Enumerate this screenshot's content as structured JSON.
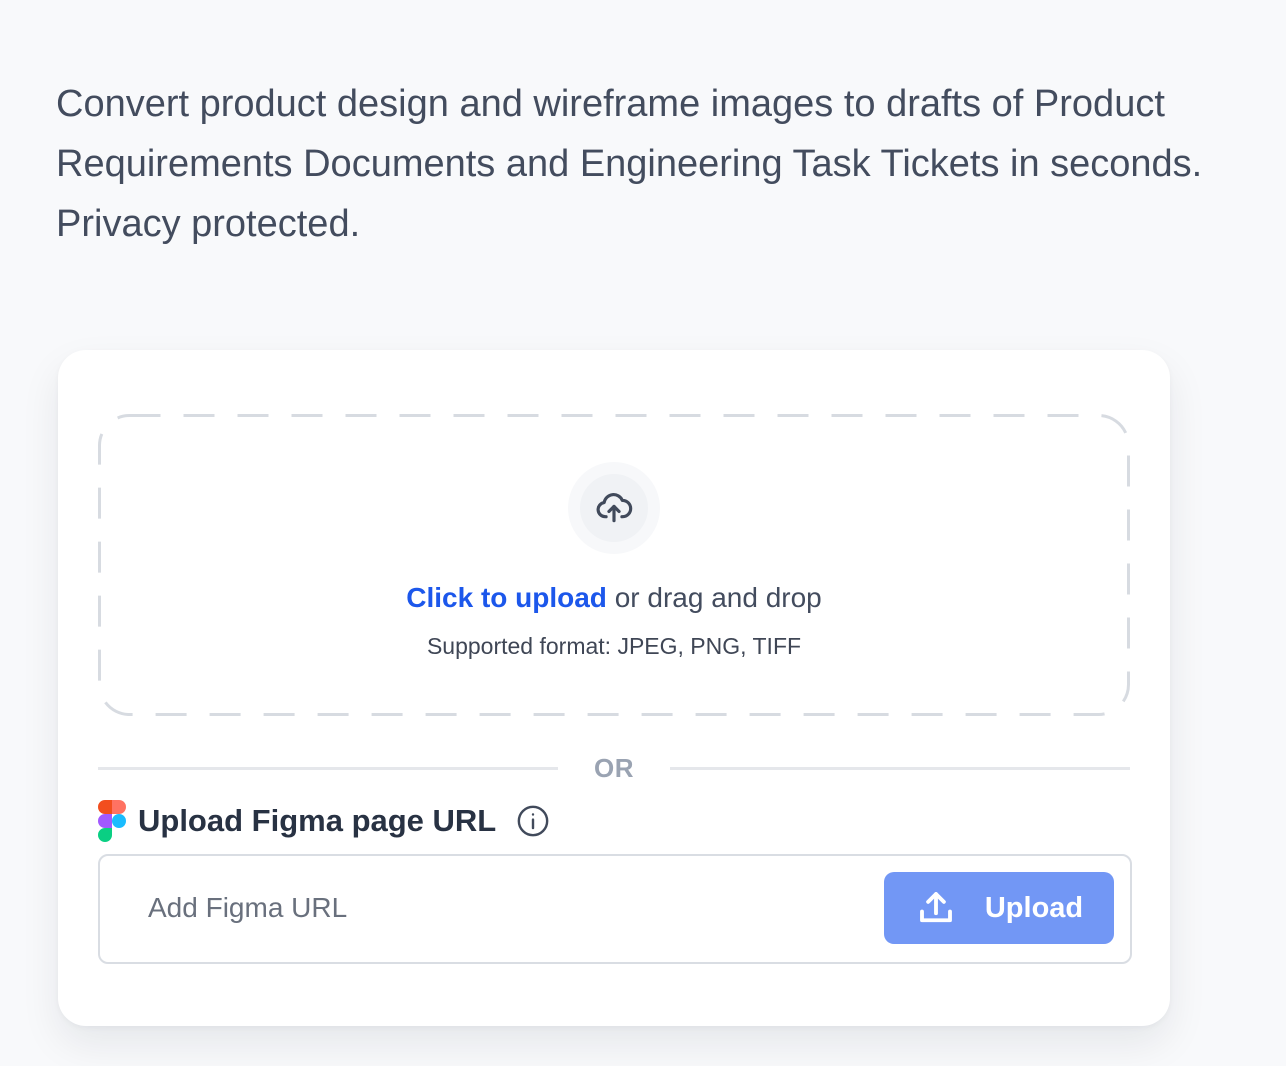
{
  "intro": {
    "text": "Convert product design and wireframe images to drafts of Product Requirements Documents and Engineering Task Tickets in seconds. Privacy protected."
  },
  "dropzone": {
    "icon": "cloud-upload-icon",
    "link_text": "Click to upload",
    "rest_text": "or drag and drop",
    "formats_text": "Supported format: JPEG, PNG, TIFF"
  },
  "divider": {
    "label": "OR"
  },
  "figma": {
    "logo": "figma-logo",
    "title": "Upload Figma page URL",
    "info_icon": "info-icon",
    "placeholder": "Add Figma URL",
    "button_label": "Upload",
    "button_icon": "upload-icon"
  },
  "colors": {
    "background": "#f8f9fb",
    "card": "#ffffff",
    "body_text": "#434c5e",
    "link": "#1c57eb",
    "button": "#7297f5",
    "divider_text": "#9aa3b2",
    "border": "#d9dde3"
  }
}
